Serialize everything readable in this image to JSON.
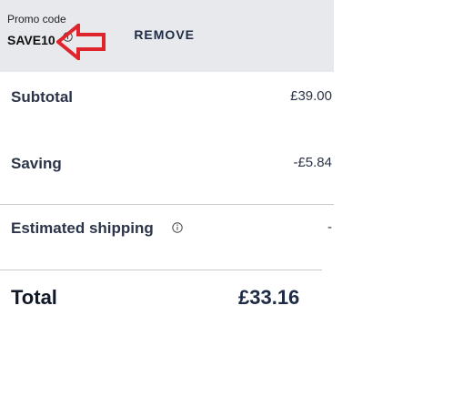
{
  "promo": {
    "label": "Promo code",
    "code": "SAVE10",
    "remove_label": "REMOVE"
  },
  "summary": {
    "subtotal_label": "Subtotal",
    "subtotal_value": "£39.00",
    "saving_label": "Saving",
    "saving_value": "-£5.84",
    "shipping_label": "Estimated shipping",
    "shipping_value": "-",
    "total_label": "Total",
    "total_value": "£33.16"
  },
  "colors": {
    "promo_background": "#e8e9ed",
    "text": "#2b3448",
    "annotation": "#e0242b"
  },
  "icons": {
    "promo_info": "info-icon",
    "shipping_info": "info-icon",
    "annotation_arrow": "left-arrow-annotation-icon"
  }
}
